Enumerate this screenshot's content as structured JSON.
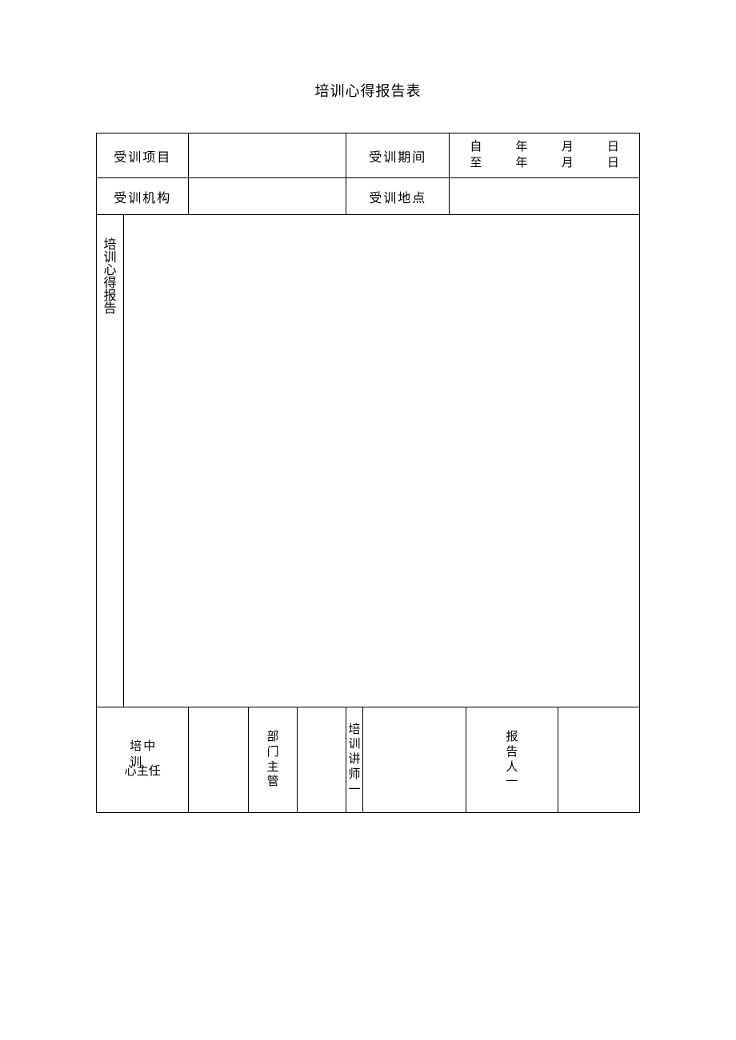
{
  "title": "培训心得报告表",
  "labels": {
    "project": "受训项目",
    "period": "受训期间",
    "org": "受训机构",
    "location": "受训地点"
  },
  "period": {
    "from": "自",
    "to": "至",
    "year": "年",
    "month": "月",
    "day": "日"
  },
  "report_label": {
    "c1": "培",
    "c2": "训",
    "c3": "心",
    "c4": "得",
    "c5": "报",
    "c6": "告"
  },
  "signatures": {
    "director_col1_a": "培",
    "director_col1_b": "训",
    "director_col2_a": "中",
    "director_tail_a": "心",
    "director_tail_b": "主",
    "director_tail_c": "任",
    "dept_a": "部",
    "dept_b": "门",
    "dept_c": "主",
    "dept_d": "管",
    "lect_a": "培",
    "lect_b": "训",
    "lect_c": "讲",
    "lect_d": "师",
    "lect_e": "一",
    "rep_a": "报",
    "rep_b": "告",
    "rep_c": "人",
    "rep_d": "一"
  },
  "fields": {
    "project_value": "",
    "org_value": "",
    "location_value": "",
    "report_body": "",
    "director_sign": "",
    "dept_sign": "",
    "lect_sign": "",
    "rep_sign": ""
  }
}
